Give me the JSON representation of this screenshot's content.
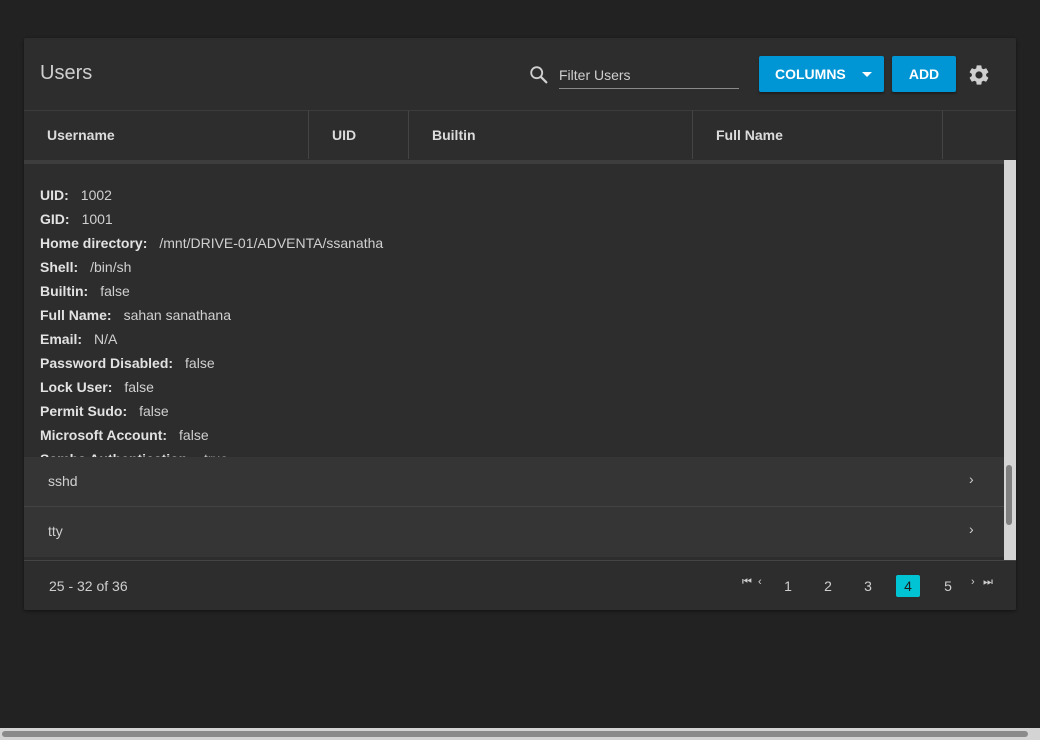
{
  "page": {
    "title": "Users"
  },
  "toolbar": {
    "search_placeholder": "Filter Users",
    "search_icon": "search-icon",
    "columns_label": "COLUMNS",
    "add_label": "ADD",
    "settings_icon": "gear-icon",
    "accent_color": "#0095d5"
  },
  "columns": [
    "Username",
    "UID",
    "Builtin",
    "Full Name"
  ],
  "details": [
    {
      "key": "UID:",
      "value": "1002"
    },
    {
      "key": "GID:",
      "value": "1001"
    },
    {
      "key": "Home directory:",
      "value": "/mnt/DRIVE-01/ADVENTA/ssanatha"
    },
    {
      "key": "Shell:",
      "value": "/bin/sh"
    },
    {
      "key": "Builtin:",
      "value": "false"
    },
    {
      "key": "Full Name:",
      "value": "sahan sanathana"
    },
    {
      "key": "Email:",
      "value": "N/A"
    },
    {
      "key": "Password Disabled:",
      "value": "false"
    },
    {
      "key": "Lock User:",
      "value": "false"
    },
    {
      "key": "Permit Sudo:",
      "value": "false"
    },
    {
      "key": "Microsoft Account:",
      "value": "false"
    },
    {
      "key": "Samba Authentication:",
      "value": "true"
    }
  ],
  "rows": [
    {
      "username": "sshd",
      "expand_icon": "chevron-right-icon"
    },
    {
      "username": "tty",
      "expand_icon": "chevron-right-icon"
    }
  ],
  "pagination": {
    "range": "25 - 32 of 36",
    "pages": [
      "1",
      "2",
      "3",
      "4",
      "5"
    ],
    "current_page": "4",
    "active_color": "#00c4d4",
    "first_icon": "first-page-icon",
    "prev_icon": "chevron-left-icon",
    "next_icon": "chevron-right-icon",
    "last_icon": "last-page-icon"
  }
}
